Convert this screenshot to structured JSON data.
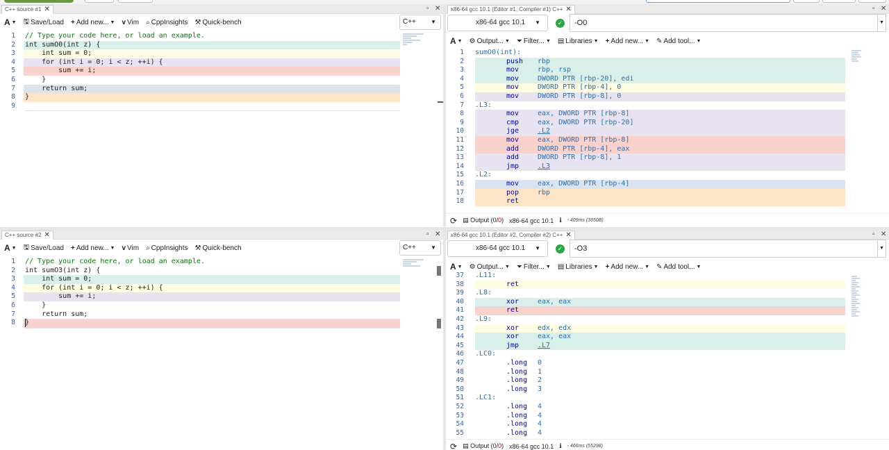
{
  "source1": {
    "tab_title": "C++ source #1",
    "toolbar": {
      "font": "A",
      "save_load": "Save/Load",
      "add_new": "Add new...",
      "vim": "Vim",
      "cppinsights": "CppInsights",
      "quickbench": "Quick-bench"
    },
    "language": "C++",
    "lines": [
      {
        "n": "1",
        "text": "// Type your code here, or load an example.",
        "hl": ""
      },
      {
        "n": "2",
        "text": "int sumO0(int z) {",
        "hl": "#d9efe9"
      },
      {
        "n": "3",
        "text": "    int sum = 0;",
        "hl": "#fdfbe1"
      },
      {
        "n": "4",
        "text": "    for (int i = 0; i < z; ++i) {",
        "hl": "#e7e3f0"
      },
      {
        "n": "5",
        "text": "        sum += i;",
        "hl": "#f9d2cd"
      },
      {
        "n": "6",
        "text": "    }",
        "hl": ""
      },
      {
        "n": "7",
        "text": "    return sum;",
        "hl": "#d9e4ef"
      },
      {
        "n": "8",
        "text": "}",
        "hl": "#fde4c8"
      },
      {
        "n": "9",
        "text": "",
        "hl": ""
      }
    ]
  },
  "source2": {
    "tab_title": "C++ source #2",
    "toolbar": {
      "font": "A",
      "save_load": "Save/Load",
      "add_new": "Add new...",
      "vim": "Vim",
      "cppinsights": "CppInsights",
      "quickbench": "Quick-bench"
    },
    "language": "C++",
    "lines": [
      {
        "n": "1",
        "text": "// Type your code here, or load an example.",
        "hl": ""
      },
      {
        "n": "2",
        "text": "int sumO3(int z) {",
        "hl": ""
      },
      {
        "n": "3",
        "text": "    int sum = 0;",
        "hl": "#d9efe9"
      },
      {
        "n": "4",
        "text": "    for (int i = 0; i < z; ++i) {",
        "hl": "#fdfbe1"
      },
      {
        "n": "5",
        "text": "        sum += i;",
        "hl": "#e7e3f0"
      },
      {
        "n": "6",
        "text": "    }",
        "hl": ""
      },
      {
        "n": "7",
        "text": "    return sum;",
        "hl": ""
      },
      {
        "n": "8",
        "text": "}",
        "hl": "#f9d2cd"
      }
    ]
  },
  "compiler1": {
    "tab_title": "x86-64 gcc 10.1 (Editor #1, Compiler #1) C++",
    "compiler": "x86-64 gcc 10.1",
    "options": "-O0",
    "toolbar": {
      "font": "A",
      "output": "Output...",
      "filter": "Filter...",
      "libraries": "Libraries",
      "add_new": "Add new...",
      "add_tool": "Add tool..."
    },
    "lines": [
      {
        "n": "1",
        "label": "sumO0(int):",
        "op": "",
        "args": "",
        "hl": ""
      },
      {
        "n": "2",
        "label": "",
        "op": "push",
        "args": "rbp",
        "hl": "#d9efe9"
      },
      {
        "n": "3",
        "label": "",
        "op": "mov",
        "args": "rbp, rsp",
        "hl": "#d9efe9"
      },
      {
        "n": "4",
        "label": "",
        "op": "mov",
        "args": "DWORD PTR [rbp-20], edi",
        "hl": "#d9efe9"
      },
      {
        "n": "5",
        "label": "",
        "op": "mov",
        "args": "DWORD PTR [rbp-4], 0",
        "hl": "#fdfbe1"
      },
      {
        "n": "6",
        "label": "",
        "op": "mov",
        "args": "DWORD PTR [rbp-8], 0",
        "hl": "#e7e3f0"
      },
      {
        "n": "7",
        "label": ".L3:",
        "op": "",
        "args": "",
        "hl": ""
      },
      {
        "n": "8",
        "label": "",
        "op": "mov",
        "args": "eax, DWORD PTR [rbp-8]",
        "hl": "#e7e3f0"
      },
      {
        "n": "9",
        "label": "",
        "op": "cmp",
        "args": "eax, DWORD PTR [rbp-20]",
        "hl": "#e7e3f0"
      },
      {
        "n": "10",
        "label": "",
        "op": "jge",
        "args": ".L2",
        "hl": "#e7e3f0"
      },
      {
        "n": "11",
        "label": "",
        "op": "mov",
        "args": "eax, DWORD PTR [rbp-8]",
        "hl": "#f9d2cd"
      },
      {
        "n": "12",
        "label": "",
        "op": "add",
        "args": "DWORD PTR [rbp-4], eax",
        "hl": "#f9d2cd"
      },
      {
        "n": "13",
        "label": "",
        "op": "add",
        "args": "DWORD PTR [rbp-8], 1",
        "hl": "#e7e3f0"
      },
      {
        "n": "14",
        "label": "",
        "op": "jmp",
        "args": ".L3",
        "hl": "#e7e3f0"
      },
      {
        "n": "15",
        "label": ".L2:",
        "op": "",
        "args": "",
        "hl": ""
      },
      {
        "n": "16",
        "label": "",
        "op": "mov",
        "args": "eax, DWORD PTR [rbp-4]",
        "hl": "#d9e4ef"
      },
      {
        "n": "17",
        "label": "",
        "op": "pop",
        "args": "rbp",
        "hl": "#fde4c8"
      },
      {
        "n": "18",
        "label": "",
        "op": "ret",
        "args": "",
        "hl": "#fde4c8"
      }
    ],
    "status": {
      "output": "Output (",
      "output_count": "0",
      "output_sep": "/",
      "output_err": "0",
      "output_close": ")",
      "compiler": "x86-64 gcc 10.1",
      "timing": "- 409ms (3650B)"
    }
  },
  "compiler2": {
    "tab_title": "x86-64 gcc 10.1 (Editor #2, Compiler #2) C++",
    "compiler": "x86-64 gcc 10.1",
    "options": "-O3",
    "toolbar": {
      "font": "A",
      "output": "Output...",
      "filter": "Filter...",
      "libraries": "Libraries",
      "add_new": "Add new...",
      "add_tool": "Add tool..."
    },
    "lines": [
      {
        "n": "37",
        "label": ".L11:",
        "op": "",
        "args": "",
        "hl": ""
      },
      {
        "n": "38",
        "label": "",
        "op": "ret",
        "args": "",
        "hl": "#fdfbe1"
      },
      {
        "n": "39",
        "label": ".L8:",
        "op": "",
        "args": "",
        "hl": ""
      },
      {
        "n": "40",
        "label": "",
        "op": "xor",
        "args": "eax, eax",
        "hl": "#d9efe9"
      },
      {
        "n": "41",
        "label": "",
        "op": "ret",
        "args": "",
        "hl": "#f9d2cd"
      },
      {
        "n": "42",
        "label": ".L9:",
        "op": "",
        "args": "",
        "hl": ""
      },
      {
        "n": "43",
        "label": "",
        "op": "xor",
        "args": "edx, edx",
        "hl": "#fdfbe1"
      },
      {
        "n": "44",
        "label": "",
        "op": "xor",
        "args": "eax, eax",
        "hl": "#d9efe9"
      },
      {
        "n": "45",
        "label": "",
        "op": "jmp",
        "args": ".L7",
        "hl": "#d9efe9"
      },
      {
        "n": "46",
        "label": ".LC0:",
        "op": "",
        "args": "",
        "hl": ""
      },
      {
        "n": "47",
        "label": "",
        "op": ".long",
        "args": "0",
        "hl": ""
      },
      {
        "n": "48",
        "label": "",
        "op": ".long",
        "args": "1",
        "hl": ""
      },
      {
        "n": "49",
        "label": "",
        "op": ".long",
        "args": "2",
        "hl": ""
      },
      {
        "n": "50",
        "label": "",
        "op": ".long",
        "args": "3",
        "hl": ""
      },
      {
        "n": "51",
        "label": ".LC1:",
        "op": "",
        "args": "",
        "hl": ""
      },
      {
        "n": "52",
        "label": "",
        "op": ".long",
        "args": "4",
        "hl": ""
      },
      {
        "n": "53",
        "label": "",
        "op": ".long",
        "args": "4",
        "hl": ""
      },
      {
        "n": "54",
        "label": "",
        "op": ".long",
        "args": "4",
        "hl": ""
      },
      {
        "n": "55",
        "label": "",
        "op": ".long",
        "args": "4",
        "hl": ""
      }
    ],
    "status": {
      "output": "Output (",
      "output_count": "0",
      "output_sep": "/",
      "output_err": "0",
      "output_close": ")",
      "compiler": "x86-64 gcc 10.1",
      "timing": "- 466ms (55298)"
    }
  }
}
